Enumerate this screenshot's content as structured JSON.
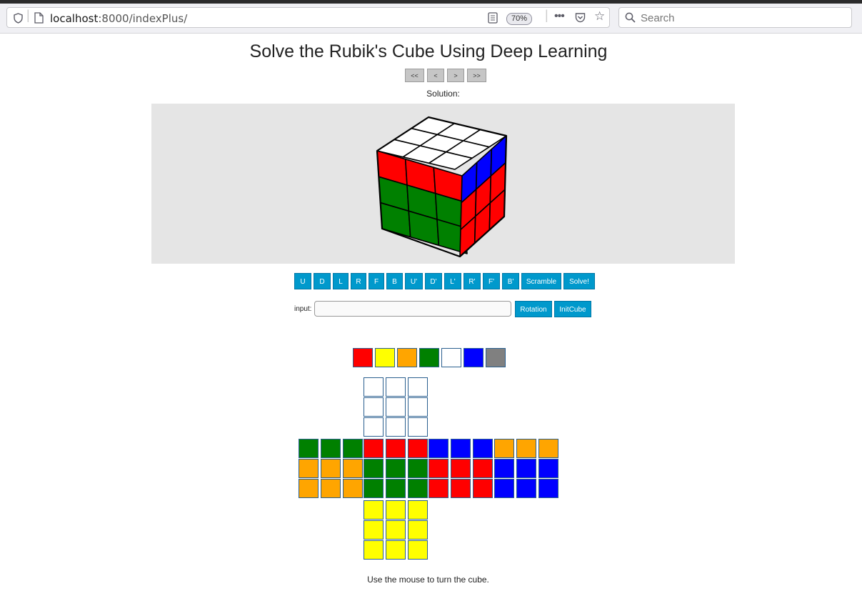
{
  "browser": {
    "url_host": "localhost",
    "url_path": ":8000/indexPlus/",
    "zoom": "70%",
    "search_placeholder": "Search"
  },
  "page": {
    "title": "Solve the Rubik's Cube Using Deep Learning",
    "nav": [
      "<<",
      "<",
      ">",
      ">>"
    ],
    "solution_label": "Solution:",
    "moves": [
      "U",
      "D",
      "L",
      "R",
      "F",
      "B",
      "U'",
      "D'",
      "L'",
      "R'",
      "F'",
      "B'",
      "Scramble",
      "Solve!"
    ],
    "input_label": "input:",
    "input_value": "",
    "rotation_label": "Rotation",
    "initcube_label": "InitCube",
    "hint": "Use the mouse to turn the cube."
  },
  "colors": {
    "R": "#ff0000",
    "Y": "#ffff00",
    "O": "#ffa500",
    "G": "#008000",
    "W": "#ffffff",
    "B": "#0000ff",
    "X": "#808080"
  },
  "palette": [
    "R",
    "Y",
    "O",
    "G",
    "W",
    "B",
    "X"
  ],
  "cube_view": {
    "top": [
      "W",
      "W",
      "W",
      "W",
      "W",
      "W",
      "W",
      "W",
      "W"
    ],
    "front": [
      "R",
      "R",
      "R",
      "G",
      "G",
      "G",
      "G",
      "G",
      "G"
    ],
    "right": [
      "B",
      "B",
      "B",
      "R",
      "R",
      "R",
      "R",
      "R",
      "R"
    ]
  },
  "net": {
    "U": [
      "W",
      "W",
      "W",
      "W",
      "W",
      "W",
      "W",
      "W",
      "W"
    ],
    "L": [
      "G",
      "G",
      "G",
      "O",
      "O",
      "O",
      "O",
      "O",
      "O"
    ],
    "F": [
      "R",
      "R",
      "R",
      "G",
      "G",
      "G",
      "G",
      "G",
      "G"
    ],
    "R": [
      "B",
      "B",
      "B",
      "R",
      "R",
      "R",
      "R",
      "R",
      "R"
    ],
    "B": [
      "O",
      "O",
      "O",
      "B",
      "B",
      "B",
      "B",
      "B",
      "B"
    ],
    "D": [
      "Y",
      "Y",
      "Y",
      "Y",
      "Y",
      "Y",
      "Y",
      "Y",
      "Y"
    ]
  }
}
